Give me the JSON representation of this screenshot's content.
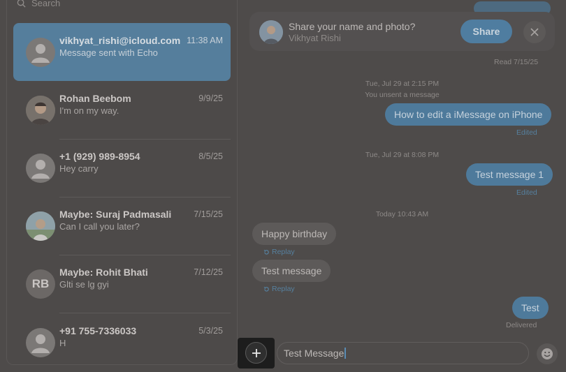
{
  "sidebar": {
    "search_placeholder": "Search",
    "conversations": [
      {
        "name": "vikhyat_rishi@icloud.com",
        "preview": "Message sent with Echo",
        "time": "11:38 AM",
        "active": true
      },
      {
        "name": "Rohan Beebom",
        "preview": "I'm on my way.",
        "time": "9/9/25"
      },
      {
        "name": "+1 (929) 989-8954",
        "preview": "Hey carry",
        "time": "8/5/25"
      },
      {
        "name": "Maybe: Suraj Padmasali",
        "preview": "Can I call you later?",
        "time": "7/15/25"
      },
      {
        "name": "Maybe: Rohit Bhati",
        "preview": "Glti se lg gyi",
        "time": "7/12/25",
        "initials": "RB"
      },
      {
        "name": "+91 755-7336033",
        "preview": "H",
        "time": "5/3/25"
      }
    ]
  },
  "banner": {
    "title": "Share your name and photo?",
    "subtitle": "Vikhyat Rishi",
    "share_label": "Share"
  },
  "thread": {
    "read_receipt": "Read 7/15/25",
    "ts1": "Tue, Jul 29 at 2:15 PM",
    "unsent_notice": "You unsent a message",
    "msg1": "How to edit a iMessage on iPhone",
    "edited1": "Edited",
    "ts2": "Tue, Jul 29 at 8:08 PM",
    "msg2": "Test message 1",
    "edited2": "Edited",
    "ts3": "Today 10:43 AM",
    "msg3": "Happy birthday",
    "replay3": "Replay",
    "msg4": "Test message",
    "replay4": "Replay",
    "msg5": "Test",
    "delivered": "Delivered"
  },
  "composer": {
    "value": "Test Message"
  },
  "colors": {
    "accent": "#4e7a9b",
    "selected_row": "#557e9c",
    "background": "#4e4b4a"
  }
}
